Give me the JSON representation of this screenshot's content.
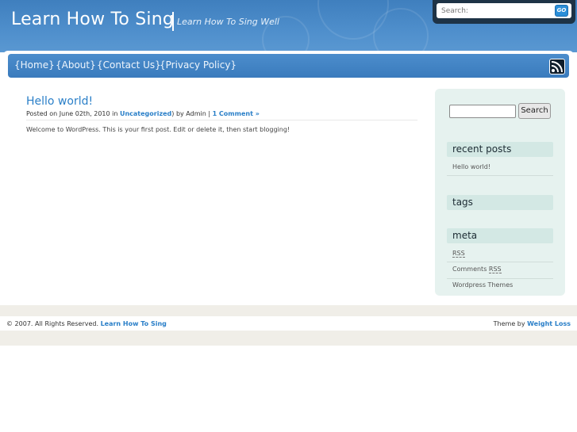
{
  "header": {
    "site_title": "Learn How To Sing",
    "tagline": "Learn How To Sing Well",
    "search_placeholder": "Search:",
    "search_go": "GO"
  },
  "nav": {
    "items": [
      "{Home}",
      "{About}",
      "{Contact Us}",
      "{Privacy Policy}"
    ],
    "rss_icon": "rss-feed-icon"
  },
  "post": {
    "title": "Hello world!",
    "meta_prefix": "Posted on June 02th, 2010 in ",
    "category": "Uncategorized",
    "meta_mid": ") by Admin | ",
    "comments": "1 Comment »",
    "body": "Welcome to WordPress. This is your first post. Edit or delete it, then start blogging!"
  },
  "sidebar": {
    "search_button": "Search",
    "recent_posts_title": "recent posts",
    "recent_posts": [
      "Hello world!"
    ],
    "tags_title": "tags",
    "meta_title": "meta",
    "meta_items": {
      "rss": "RSS",
      "comments_prefix": "Comments ",
      "comments_rss": "RSS",
      "themes": "Wordpress Themes"
    }
  },
  "footer": {
    "copyright": "© 2007. All Rights Reserved.",
    "site_link": "Learn How To Sing",
    "theme_by": "Theme by",
    "theme_link": "Weight Loss"
  },
  "colors": {
    "header_blue": "#4f8fcc",
    "link_blue": "#2a7fc8",
    "sidebar_bg": "#e6f2ef",
    "widget_head_bg": "#d3e8e4"
  }
}
